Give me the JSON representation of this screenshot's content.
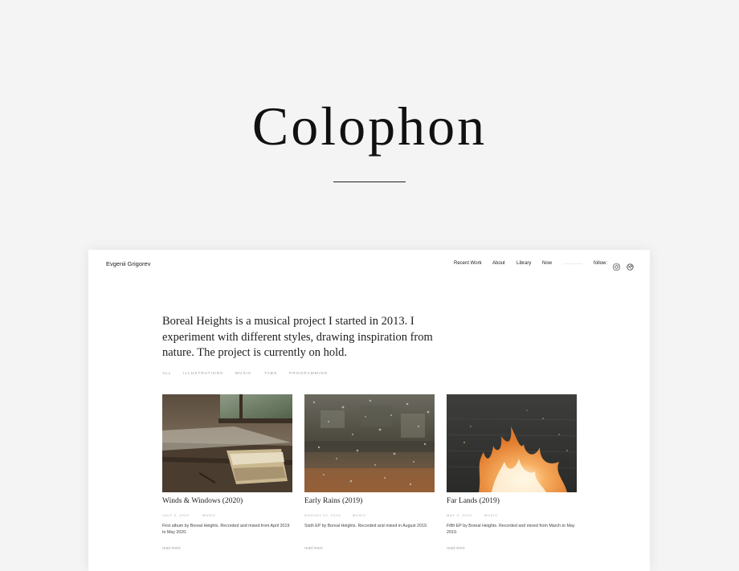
{
  "hero": {
    "title": "Colophon"
  },
  "site": {
    "name": "Evgenii Grigorev",
    "nav": [
      "Recent Work",
      "About",
      "Library",
      "Now"
    ],
    "follow_label": "follow:",
    "icons": [
      "instagram-icon",
      "dribbble-icon"
    ]
  },
  "intro": "Boreal Heights is a musical project I started in 2013. I experiment with different styles, drawing inspiration from nature. The project is currently on hold.",
  "filters": [
    "ALL",
    "ILLUSTRATIONS",
    "MUSIC",
    "TABS",
    "PROGRAMMING"
  ],
  "cards": [
    {
      "title": "Winds & Windows (2020)",
      "date": "JULY 3, 2020",
      "category": "MUSIC",
      "description": "First album by Boreal Heights. Recorded and mixed from April 2019 to May 2020.",
      "more": "read more"
    },
    {
      "title": "Early Rains (2019)",
      "date": "AUGUST 12, 2019",
      "category": "MUSIC",
      "description": "Sixth EP by Boreal Heights. Recorded and mixed in August 2019.",
      "more": "read more"
    },
    {
      "title": "Far Lands (2019)",
      "date": "MAY 9, 2019",
      "category": "MUSIC",
      "description": "Fifth EP by Boreal Heights. Recorded and mixed from March to May 2019.",
      "more": "read more"
    }
  ]
}
